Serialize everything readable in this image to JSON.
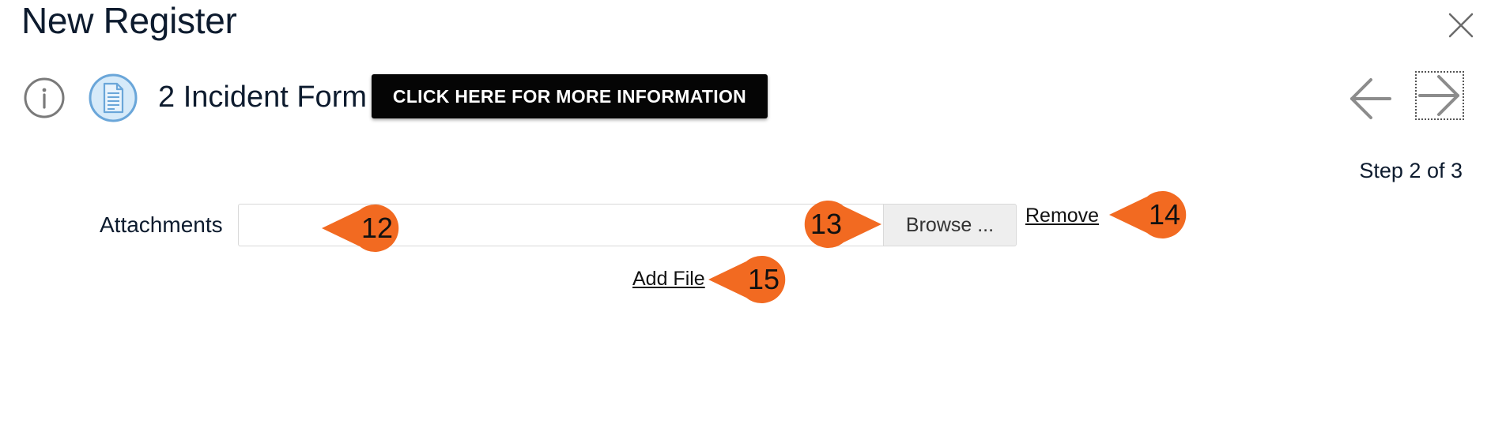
{
  "header": {
    "title": "New Register"
  },
  "form": {
    "title": "2 Incident Form",
    "info_button_label": "CLICK HERE FOR MORE INFORMATION",
    "step_indicator": "Step 2 of 3"
  },
  "attachments": {
    "label": "Attachments",
    "file_value": "",
    "browse_label": "Browse ...",
    "remove_label": "Remove",
    "add_file_label": "Add File"
  },
  "callouts": [
    "12",
    "13",
    "14",
    "15"
  ],
  "colors": {
    "callout": "#f26a21",
    "icon_blue": "#6aa6d9",
    "banner_bg": "#050505",
    "text_dark": "#0d1b2e"
  }
}
